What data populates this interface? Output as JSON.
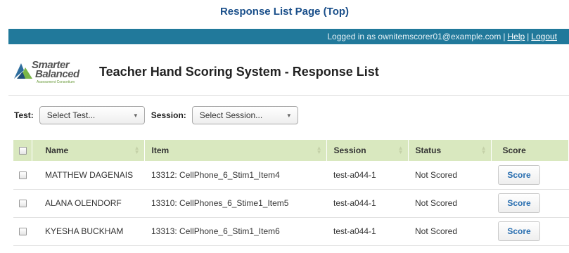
{
  "caption": "Response List Page (Top)",
  "topbar": {
    "logged_in_text": "Logged in as ownitemscorer01@example.com",
    "separator": "|",
    "help_label": "Help",
    "logout_label": "Logout",
    "background_color": "#21799b"
  },
  "header": {
    "logo": {
      "line1": "Smarter",
      "line2": "Balanced",
      "line3": "Assessment Consortium"
    },
    "title": "Teacher Hand Scoring System - Response List"
  },
  "filters": {
    "test_label": "Test:",
    "test_value": "Select Test...",
    "session_label": "Session:",
    "session_value": "Select Session..."
  },
  "table": {
    "header_color": "#d9e8bf",
    "columns": {
      "name": "Name",
      "item": "Item",
      "session": "Session",
      "status": "Status",
      "score": "Score"
    },
    "rows": [
      {
        "name": "MATTHEW DAGENAIS",
        "item": "13312: CellPhone_6_Stim1_Item4",
        "session": "test-a044-1",
        "status": "Not Scored",
        "action": "Score"
      },
      {
        "name": "ALANA OLENDORF",
        "item": "13310: CellPhones_6_Stime1_Item5",
        "session": "test-a044-1",
        "status": "Not Scored",
        "action": "Score"
      },
      {
        "name": "KYESHA BUCKHAM",
        "item": "13313: CellPhone_6_Stim1_Item6",
        "session": "test-a044-1",
        "status": "Not Scored",
        "action": "Score"
      }
    ]
  }
}
